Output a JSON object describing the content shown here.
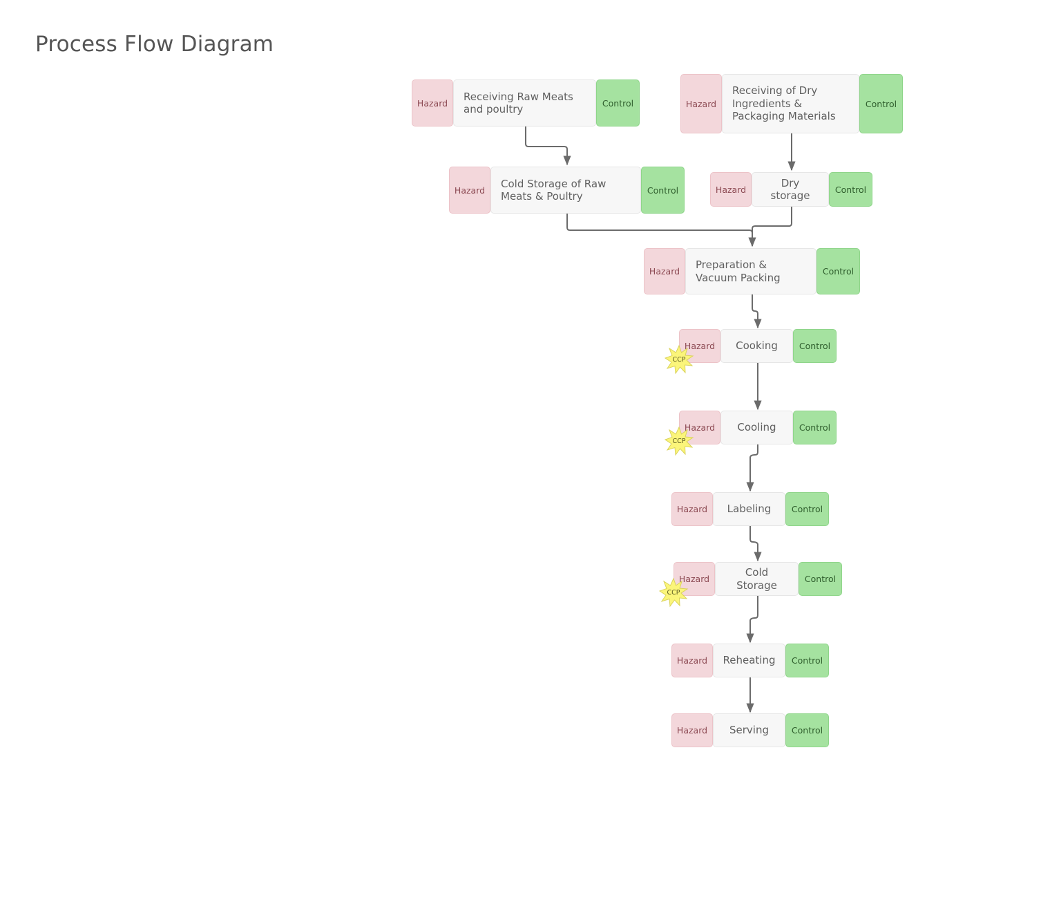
{
  "title": "Process Flow Diagram",
  "labels": {
    "hazard": "Hazard",
    "control": "Control",
    "ccp": "CCP"
  },
  "colors": {
    "hazard_fill": "#f3d7db",
    "control_fill": "#a5e2a0",
    "step_fill": "#f7f7f7",
    "ccp_fill": "#fbf57a",
    "connector": "#6b6b6b"
  },
  "steps": [
    {
      "id": "receiving-raw-meats",
      "label": "Receiving Raw Meats and poultry",
      "ccp": false
    },
    {
      "id": "receiving-dry",
      "label": "Receiving of Dry Ingredients & Packaging Materials",
      "ccp": false
    },
    {
      "id": "cold-storage-raw",
      "label": "Cold Storage of Raw Meats & Poultry",
      "ccp": false
    },
    {
      "id": "dry-storage",
      "label": "Dry storage",
      "ccp": false
    },
    {
      "id": "preparation",
      "label": "Preparation & Vacuum Packing",
      "ccp": false
    },
    {
      "id": "cooking",
      "label": "Cooking",
      "ccp": true
    },
    {
      "id": "cooling",
      "label": "Cooling",
      "ccp": true
    },
    {
      "id": "labeling",
      "label": "Labeling",
      "ccp": false
    },
    {
      "id": "cold-storage",
      "label": "Cold Storage",
      "ccp": true
    },
    {
      "id": "reheating",
      "label": "Reheating",
      "ccp": false
    },
    {
      "id": "serving",
      "label": "Serving",
      "ccp": false
    }
  ],
  "flows": [
    {
      "from": "receiving-raw-meats",
      "to": "cold-storage-raw"
    },
    {
      "from": "receiving-dry",
      "to": "dry-storage"
    },
    {
      "from": "cold-storage-raw",
      "to": "preparation"
    },
    {
      "from": "dry-storage",
      "to": "preparation"
    },
    {
      "from": "preparation",
      "to": "cooking"
    },
    {
      "from": "cooking",
      "to": "cooling"
    },
    {
      "from": "cooling",
      "to": "labeling"
    },
    {
      "from": "labeling",
      "to": "cold-storage"
    },
    {
      "from": "cold-storage",
      "to": "reheating"
    },
    {
      "from": "reheating",
      "to": "serving"
    }
  ]
}
